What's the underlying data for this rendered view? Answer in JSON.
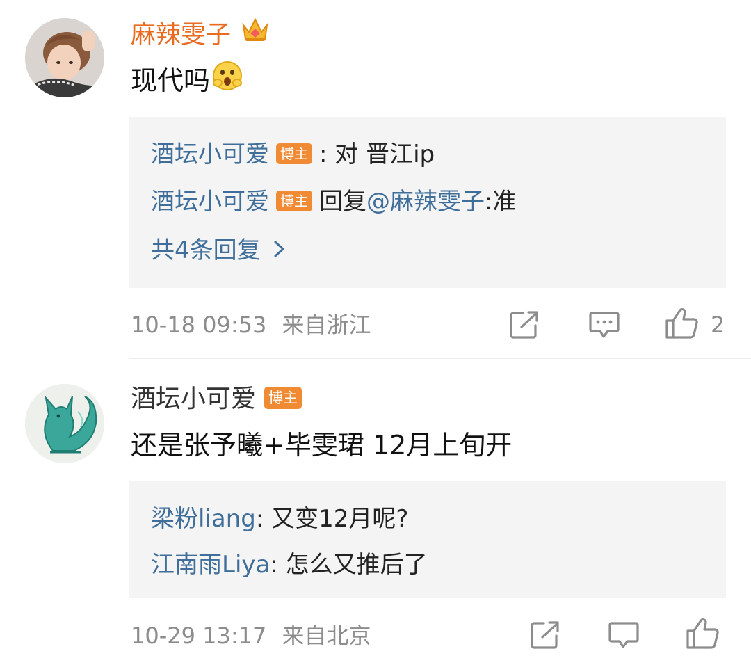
{
  "comments": [
    {
      "user": "麻辣雯子",
      "text": "现代吗",
      "replies": [
        {
          "user": "酒坛小可爱",
          "badge": "博主",
          "sep": ":",
          "text": " 对 晋江ip"
        },
        {
          "user": "酒坛小可爱",
          "badge": "博主",
          "prefix": "回复",
          "mention": "@麻辣雯子",
          "text": ":准"
        }
      ],
      "more_replies": "共4条回复",
      "time": "10-18 09:53",
      "location": "来自浙江",
      "likes": "2"
    },
    {
      "user": "酒坛小可爱",
      "badge": "博主",
      "text": "还是张予曦+毕雯珺  12月上旬开",
      "replies": [
        {
          "user": "梁粉liang",
          "text": ": 又变12月呢?"
        },
        {
          "user": "江南雨Liya",
          "text": ": 怎么又推后了"
        }
      ],
      "time": "10-29 13:17",
      "location": "来自北京"
    }
  ],
  "icons": {
    "repost": "share-arrow-icon",
    "comment": "comment-bubble-icon",
    "like": "thumbs-up-icon",
    "crown": "crown-icon",
    "emoji": "surprised-face-icon"
  },
  "colors": {
    "vip_name": "#e86b1f",
    "link": "#3e6e99",
    "badge": "#f08a33",
    "meta": "#8c8c8c",
    "reply_bg": "#f4f4f4"
  }
}
